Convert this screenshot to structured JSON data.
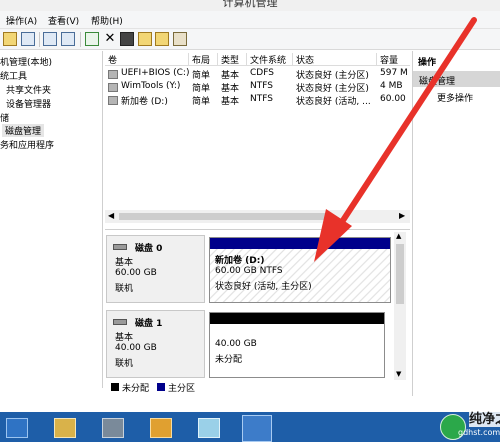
{
  "window": {
    "title": "计算机管理"
  },
  "menu": [
    "操作(A)",
    "查看(V)",
    "帮助(H)"
  ],
  "tree": {
    "items": [
      "机管理(本地)",
      "统工具",
      "共享文件夹",
      "设备管理器",
      "储",
      "磁盘管理",
      "务和应用程序"
    ]
  },
  "volume_table": {
    "columns": [
      "卷",
      "布局",
      "类型",
      "文件系统",
      "状态",
      "容量"
    ],
    "rows": [
      {
        "name": "UEFI+BIOS (C:)",
        "layout": "简单",
        "type": "基本",
        "fs": "CDFS",
        "status": "状态良好 (主分区)",
        "capacity": "597 M"
      },
      {
        "name": "WimTools (Y:)",
        "layout": "简单",
        "type": "基本",
        "fs": "NTFS",
        "status": "状态良好 (主分区)",
        "capacity": "4 MB"
      },
      {
        "name": "新加卷 (D:)",
        "layout": "简单",
        "type": "基本",
        "fs": "NTFS",
        "status": "状态良好 (活动, ...",
        "capacity": "60.00"
      }
    ]
  },
  "disks": [
    {
      "name": "磁盘 0",
      "type": "基本",
      "size": "60.00 GB",
      "state": "联机",
      "partition": {
        "name": "新加卷 (D:)",
        "size_fs": "60.00 GB NTFS",
        "status": "状态良好 (活动, 主分区)"
      }
    },
    {
      "name": "磁盘 1",
      "type": "基本",
      "size": "40.00 GB",
      "state": "联机",
      "partition": {
        "size": "40.00 GB",
        "status": "未分配"
      }
    }
  ],
  "legend": [
    "未分配",
    "主分区"
  ],
  "actions": {
    "header": "操作",
    "section": "磁盘管理",
    "more": "更多操作"
  },
  "colors": {
    "primary_partition": "#00008b",
    "unallocated": "#000000",
    "arrow": "#e8322a",
    "taskbar": "#1e5ea8"
  },
  "watermark": {
    "brand": "纯净之家",
    "url": "gdhst.com"
  }
}
